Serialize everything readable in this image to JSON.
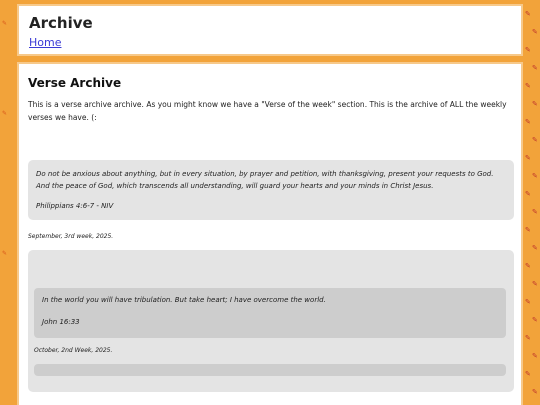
{
  "header": {
    "title": "Archive",
    "home_link": "Home"
  },
  "main": {
    "heading": "Verse Archive",
    "intro": "This is a verse archive archive. As you might know we have a \"Verse of the week\" section. This is the archive of ALL the weekly verses we have. (:",
    "entries": [
      {
        "verse": "Do not be anxious about anything, but in every situation, by prayer and petition, with thanksgiving, present your requests to God. And the peace of God, which transcends all understanding, will guard your hearts and your minds in Christ Jesus.",
        "reference": "Philippians 4:6-7 - NIV",
        "date": "September, 3rd week, 2025."
      },
      {
        "verse": "In the world you will have tribulation. But take heart; I have overcome the world.",
        "reference": "John 16:33",
        "date": "October, 2nd Week, 2025."
      }
    ]
  },
  "colors": {
    "background": "#f2a33a",
    "card": "#e4e4e4",
    "inner_card": "#cdcdcd",
    "link": "#3b3bd6"
  }
}
